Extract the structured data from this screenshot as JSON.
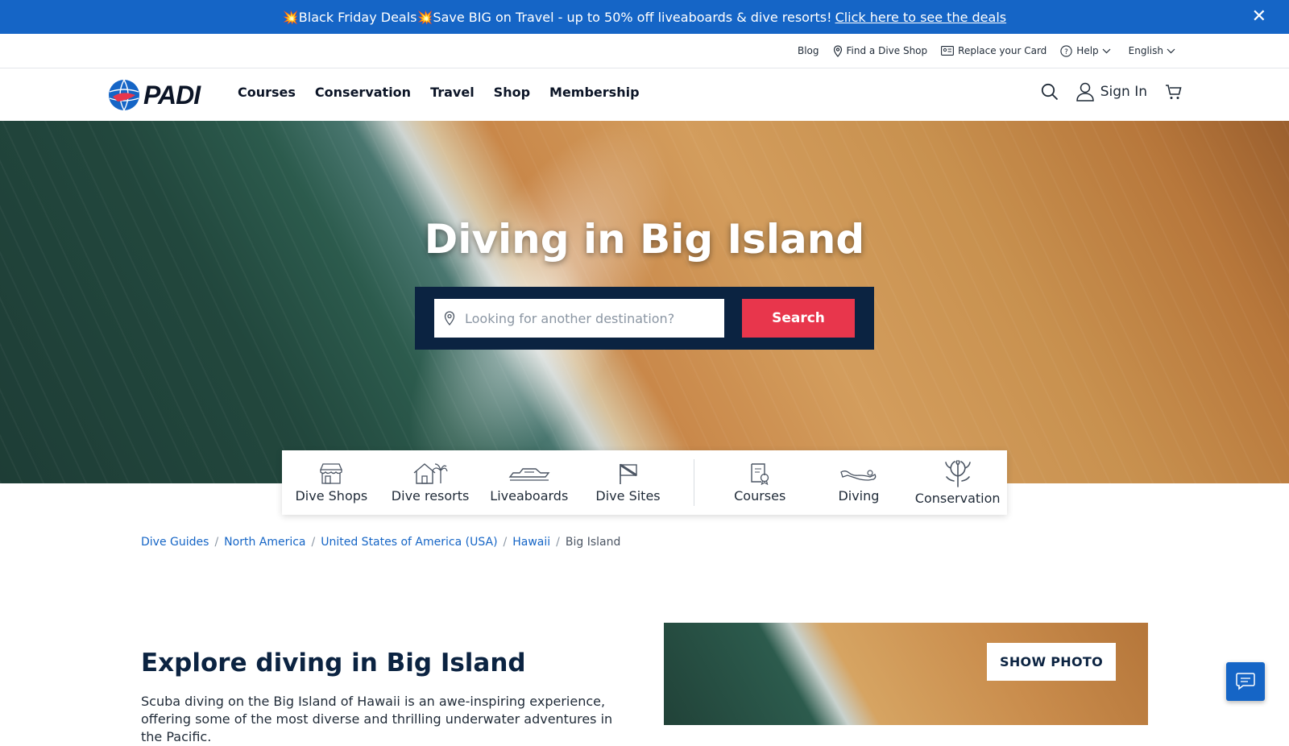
{
  "promo": {
    "text": "💥Black Friday Deals💥Save BIG on Travel - up to 50% off liveaboards & dive resorts!",
    "link": "Click here to see the deals",
    "close": "✕"
  },
  "utility": {
    "blog": "Blog",
    "find_shop": "Find a Dive Shop",
    "replace_card": "Replace your Card",
    "help": "Help",
    "language": "English"
  },
  "logo": {
    "text": "PADI"
  },
  "nav": {
    "items": [
      "Courses",
      "Conservation",
      "Travel",
      "Shop",
      "Membership"
    ],
    "sign_in": "Sign In"
  },
  "hero": {
    "title": "Diving in Big Island",
    "search_placeholder": "Looking for another destination?",
    "search_button": "Search"
  },
  "categories": [
    "Dive Shops",
    "Dive resorts",
    "Liveaboards",
    "Dive Sites",
    "Courses",
    "Diving",
    "Conservation"
  ],
  "breadcrumb": {
    "items": [
      "Dive Guides",
      "North America",
      "United States of America (USA)",
      "Hawaii"
    ],
    "current": "Big Island",
    "separator": "/"
  },
  "explore": {
    "heading": "Explore diving in Big Island",
    "body": "Scuba diving on the Big Island of Hawaii is an awe-inspiring experience, offering some of the most diverse and thrilling underwater adventures in the Pacific."
  },
  "photo": {
    "button": "SHOW PHOTO"
  },
  "colors": {
    "primary": "#1565c6",
    "navy": "#0b2341",
    "accent": "#e8364c"
  }
}
